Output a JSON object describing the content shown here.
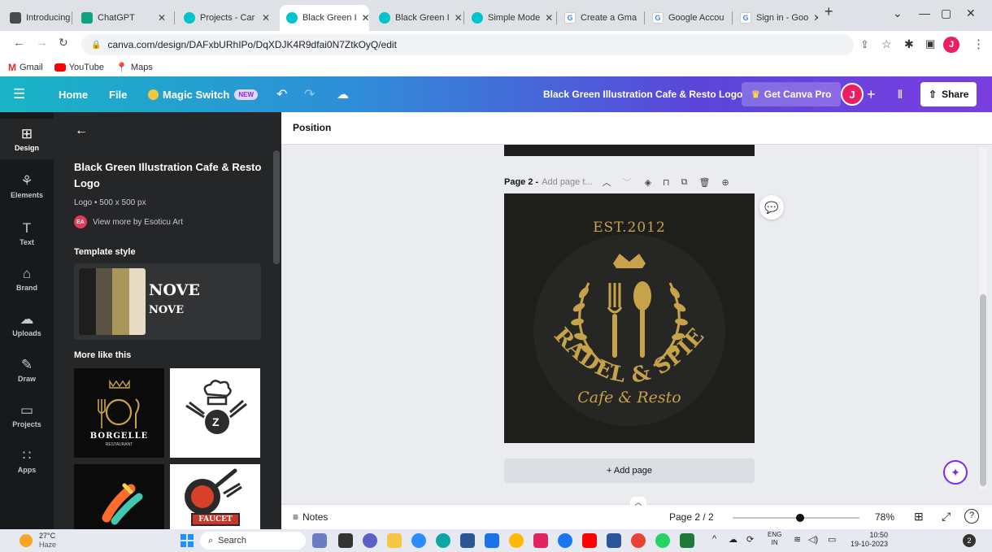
{
  "browser": {
    "tabs": [
      {
        "label": "Introducing C",
        "color": "#4a4a4a"
      },
      {
        "label": "ChatGPT",
        "color": "#10a37f"
      },
      {
        "label": "Projects - Car",
        "color": "#00c4cc"
      },
      {
        "label": "Black Green I",
        "color": "#00c4cc",
        "active": true
      },
      {
        "label": "Black Green I",
        "color": "#00c4cc"
      },
      {
        "label": "Simple Mode",
        "color": "#00c4cc"
      },
      {
        "label": "Create a Gma",
        "color": "#4285f4"
      },
      {
        "label": "Google Accou",
        "color": "#4285f4"
      },
      {
        "label": "Sign in - Goo",
        "color": "#4285f4"
      }
    ],
    "url": "canva.com/design/DAFxbURhIPo/DqXDJK4R9dfai0N7ZtkOyQ/edit",
    "bookmarks": [
      "Gmail",
      "YouTube",
      "Maps"
    ],
    "profile_letter": "J"
  },
  "header": {
    "home": "Home",
    "file": "File",
    "magic_switch": "Magic Switch",
    "new_badge": "NEW",
    "doc_title": "Black Green Illustration Cafe & Resto Logo",
    "get_pro": "Get Canva Pro",
    "avatar_letter": "J",
    "share": "Share"
  },
  "rail": [
    {
      "label": "Design",
      "icon": "◫"
    },
    {
      "label": "Elements",
      "icon": "⚘"
    },
    {
      "label": "Text",
      "icon": "T"
    },
    {
      "label": "Brand",
      "icon": "⌂"
    },
    {
      "label": "Uploads",
      "icon": "☁"
    },
    {
      "label": "Draw",
      "icon": "✎"
    },
    {
      "label": "Projects",
      "icon": "▭"
    },
    {
      "label": "Apps",
      "icon": "∷"
    }
  ],
  "panel": {
    "title": "Black Green Illustration Cafe & Resto Logo",
    "meta": "Logo • 500 x 500 px",
    "author_initials": "EA",
    "author_link": "View more by Esoticu Art",
    "template_style": "Template style",
    "style_text_1": "NOVE",
    "style_text_2": "NOVE",
    "swatches": [
      "#1e1f1c",
      "#5a5344",
      "#a8965b",
      "#e5dcc3"
    ],
    "more_like_this": "More like this",
    "thumb_1_title": "BORGELLE",
    "thumb_1_sub": "RESTAURANT",
    "thumb_2_letter": "Z",
    "thumb_4_title": "FAUCET"
  },
  "editor": {
    "position": "Position",
    "page_label": "Page 2 -",
    "page_title_placeholder": "Add page t...",
    "add_page": "+ Add page",
    "notes": "Notes",
    "page_counter": "Page 2 / 2",
    "zoom": "78%",
    "logo": {
      "est": "EST.2012",
      "brand": "FRADEL & SPIES",
      "tagline": "Cafe & Resto"
    }
  },
  "taskbar": {
    "temp": "27°C",
    "weather": "Haze",
    "search": "Search",
    "lang1": "ENG",
    "lang2": "IN",
    "time": "10:50",
    "date": "19-10-2023",
    "notif_count": "2"
  },
  "colors": {
    "logo_gold": "#c6a24a",
    "logo_bg": "#1e1f1c",
    "panel_bg": "#252627",
    "rail_bg": "#18191b"
  }
}
